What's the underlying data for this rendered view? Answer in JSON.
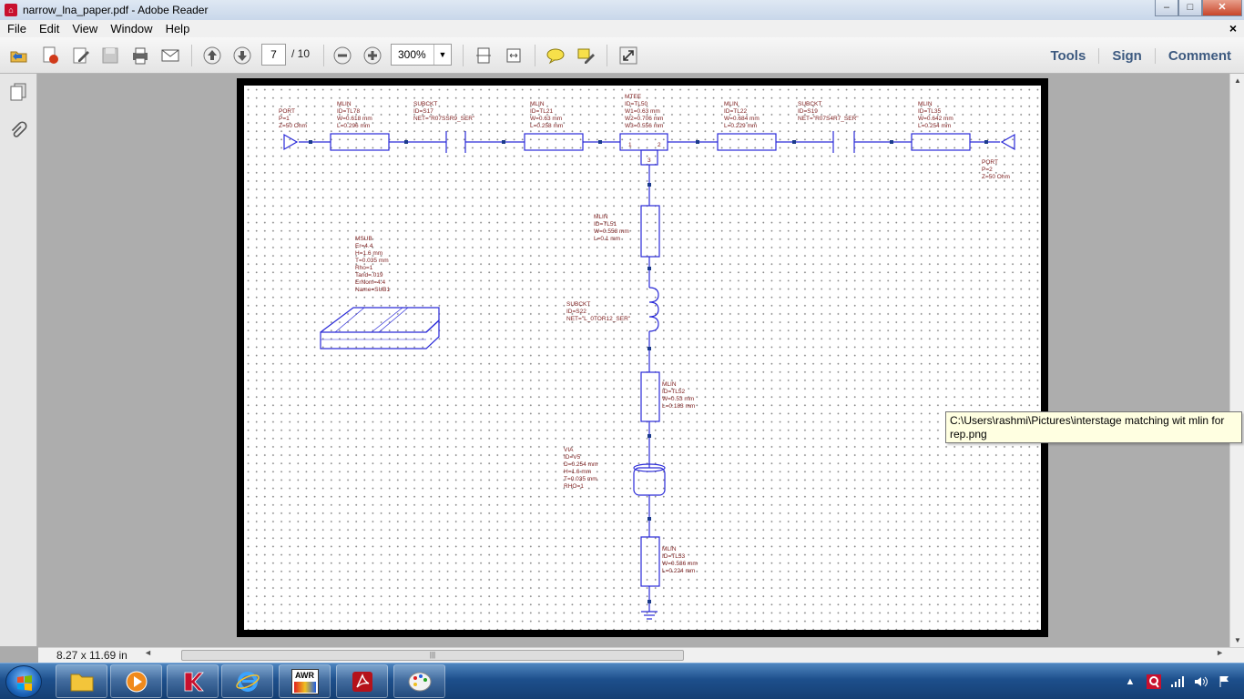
{
  "window": {
    "title": "narrow_lna_paper.pdf - Adobe Reader",
    "min_label": "–",
    "max_label": "□",
    "close_label": "✕"
  },
  "menu": {
    "items": [
      "File",
      "Edit",
      "View",
      "Window",
      "Help"
    ],
    "doc_close": "×"
  },
  "toolbar": {
    "page_current": "7",
    "page_total": "/ 10",
    "zoom": "300%",
    "zoom_dropdown": "▼",
    "links": [
      "Tools",
      "Sign",
      "Comment"
    ]
  },
  "status": {
    "page_size": "8.27 x 11.69 in",
    "scroll_left": "◄",
    "scroll_grip": "|||",
    "scroll_right": "►"
  },
  "tooltip": {
    "text": "C:\\Users\\rashmi\\Pictures\\interstage matching wit mlin for rep.png"
  },
  "schematic": {
    "port1": [
      "PORT",
      "P=1",
      "Z=50 Ohm"
    ],
    "mlin_tl78": [
      "MLIN",
      "ID=TL78",
      "W=0.618 mm",
      "L=0.296 mm"
    ],
    "subckt_s17": [
      "SUBCKT",
      "ID=S17",
      "NET=\"R07SSR9_SER\""
    ],
    "mlin_tl21": [
      "MLIN",
      "ID=TL21",
      "W=0.63 mm",
      "L=0.258 mm"
    ],
    "mtee_tl50": [
      "MTEE",
      "ID=TL50",
      "W1=0.63 mm",
      "W2=0.706 mm",
      "W3=0.556 mm"
    ],
    "mlin_tl22": [
      "MLIN",
      "ID=TL22",
      "W=0.684 mm",
      "L=0.229 mm"
    ],
    "subckt_s19": [
      "SUBCKT",
      "ID=S19",
      "NET=\"R07S4R7_SER\""
    ],
    "mlin_tl35": [
      "MLIN",
      "ID=TL35",
      "W=0.642 mm",
      "L=0.254 mm"
    ],
    "port2": [
      "PORT",
      "P=2",
      "Z=50 Ohm"
    ],
    "mlin_tl51": [
      "MLIN",
      "ID=TL51",
      "W=0.558 mm",
      "L=0.1 mm"
    ],
    "msub": [
      "MSUB",
      "Er=4.4",
      "H=1.6 mm",
      "T=0.035 mm",
      "Rho=1",
      "Tand=.019",
      "ErNom=4.4",
      "Name=SUB1"
    ],
    "subckt_s22": [
      "SUBCKT",
      "ID=S22",
      "NET=\"L_0TOR12_SER\""
    ],
    "mlin_tl52": [
      "MLIN",
      "ID=TL52",
      "W=0.53 mm",
      "L=0.183 mm"
    ],
    "via_v5": [
      "VIA",
      "ID=V5",
      "D=0.254 mm",
      "H=1.6 mm",
      "T=0.035 mm",
      "RHO=1"
    ],
    "mlin_tl53": [
      "MLIN",
      "ID=TL53",
      "W=0.536 mm",
      "L=0.224 mm"
    ],
    "tee_pins": [
      "1",
      "2",
      "3"
    ]
  },
  "taskbar": {
    "apps": [
      "explorer",
      "media-player",
      "kaspersky",
      "internet-explorer",
      "awr",
      "adobe-reader",
      "paint"
    ],
    "awr_label": "AWR"
  },
  "colors": {
    "wire": "#2a2ad8",
    "label": "#7a1a1a",
    "node": "#1a3a8a"
  }
}
